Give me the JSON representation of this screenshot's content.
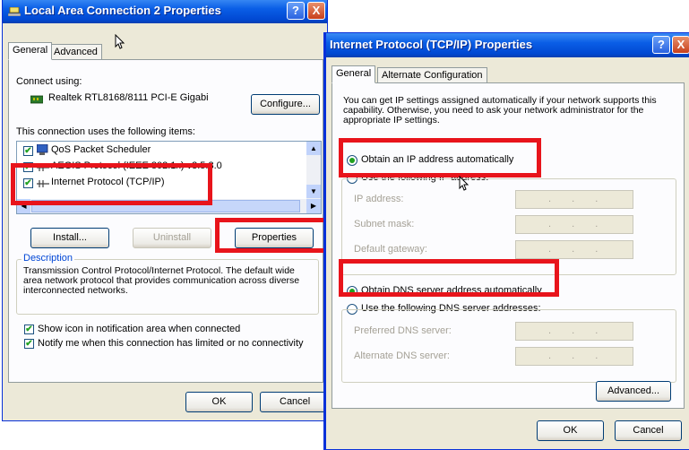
{
  "lac_window": {
    "title": "Local Area Connection 2 Properties",
    "help_btn": "?",
    "close_btn": "X",
    "tabs": [
      "General",
      "Advanced"
    ],
    "connect_using_label": "Connect using:",
    "adapter_name": "Realtek RTL8168/8111 PCI-E Gigabi",
    "configure_btn": "Configure...",
    "items_label": "This connection uses the following items:",
    "items": [
      "QoS Packet Scheduler",
      "AEGIS Protocol (IEEE 802.1x) v3.5.3.0",
      "Internet Protocol (TCP/IP)"
    ],
    "install_btn": "Install...",
    "uninstall_btn": "Uninstall",
    "properties_btn": "Properties",
    "description_title": "Description",
    "description_text": "Transmission Control Protocol/Internet Protocol. The default wide area network protocol that provides communication across diverse interconnected networks.",
    "show_icon_label": "Show icon in notification area when connected",
    "notify_label": "Notify me when this connection has limited or no connectivity",
    "ok_btn": "OK",
    "cancel_btn": "Cancel"
  },
  "tcpip_window": {
    "title": "Internet Protocol (TCP/IP) Properties",
    "help_btn": "?",
    "close_btn": "X",
    "tabs": [
      "General",
      "Alternate Configuration"
    ],
    "info_text": "You can get IP settings assigned automatically if your network supports this capability. Otherwise, you need to ask your network administrator for the appropriate IP settings.",
    "obtain_ip_label": "Obtain an IP address automatically",
    "use_ip_label": "Use the following IP address:",
    "ip_address_label": "IP address:",
    "subnet_mask_label": "Subnet mask:",
    "default_gateway_label": "Default gateway:",
    "obtain_dns_label": "Obtain DNS server address automatically",
    "use_dns_label": "Use the following DNS server addresses:",
    "preferred_dns_label": "Preferred DNS server:",
    "alternate_dns_label": "Alternate DNS server:",
    "ip_dots": ". . .",
    "advanced_btn": "Advanced...",
    "ok_btn": "OK",
    "cancel_btn": "Cancel"
  },
  "colors": {
    "highlight": "#e8141b",
    "title_blue": "#0a5ee6",
    "dialog_bg": "#ece9d8"
  }
}
